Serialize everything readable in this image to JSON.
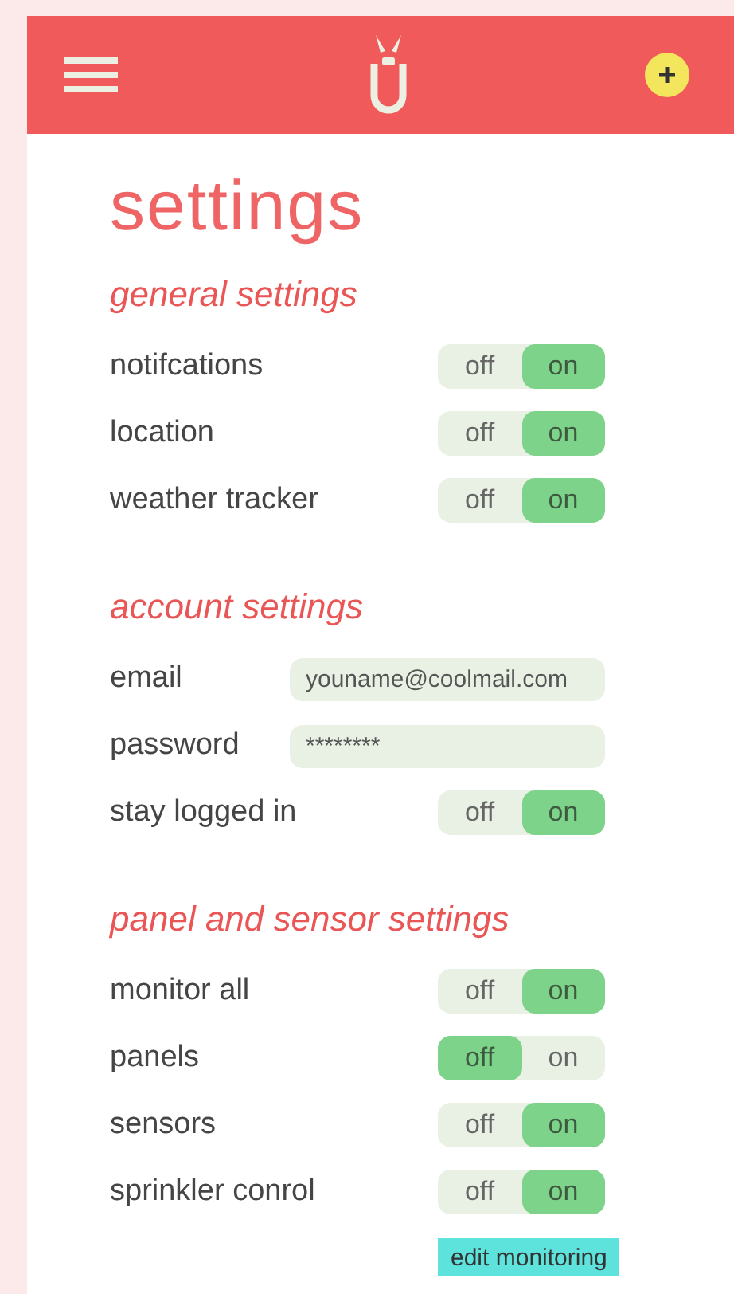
{
  "title": "settings",
  "sections": [
    {
      "heading": "general settings",
      "rows": [
        {
          "kind": "toggle",
          "label": "notifcations",
          "off_label": "off",
          "on_label": "on",
          "on": true
        },
        {
          "kind": "toggle",
          "label": "location",
          "off_label": "off",
          "on_label": "on",
          "on": true
        },
        {
          "kind": "toggle",
          "label": "weather tracker",
          "off_label": "off",
          "on_label": "on",
          "on": true
        }
      ]
    },
    {
      "heading": "account settings",
      "rows": [
        {
          "kind": "field",
          "label": "email",
          "value": "youname@coolmail.com"
        },
        {
          "kind": "field",
          "label": "password",
          "value": "********"
        },
        {
          "kind": "toggle",
          "label": "stay logged in",
          "off_label": "off",
          "on_label": "on",
          "on": true
        }
      ]
    },
    {
      "heading": "panel and sensor settings",
      "rows": [
        {
          "kind": "toggle",
          "label": "monitor all",
          "off_label": "off",
          "on_label": "on",
          "on": true
        },
        {
          "kind": "toggle",
          "label": "panels",
          "off_label": "off",
          "on_label": "on",
          "on": false
        },
        {
          "kind": "toggle",
          "label": "sensors",
          "off_label": "off",
          "on_label": "on",
          "on": true
        },
        {
          "kind": "toggle",
          "label": "sprinkler conrol",
          "off_label": "off",
          "on_label": "on",
          "on": true
        }
      ],
      "button": "edit monitoring"
    }
  ]
}
